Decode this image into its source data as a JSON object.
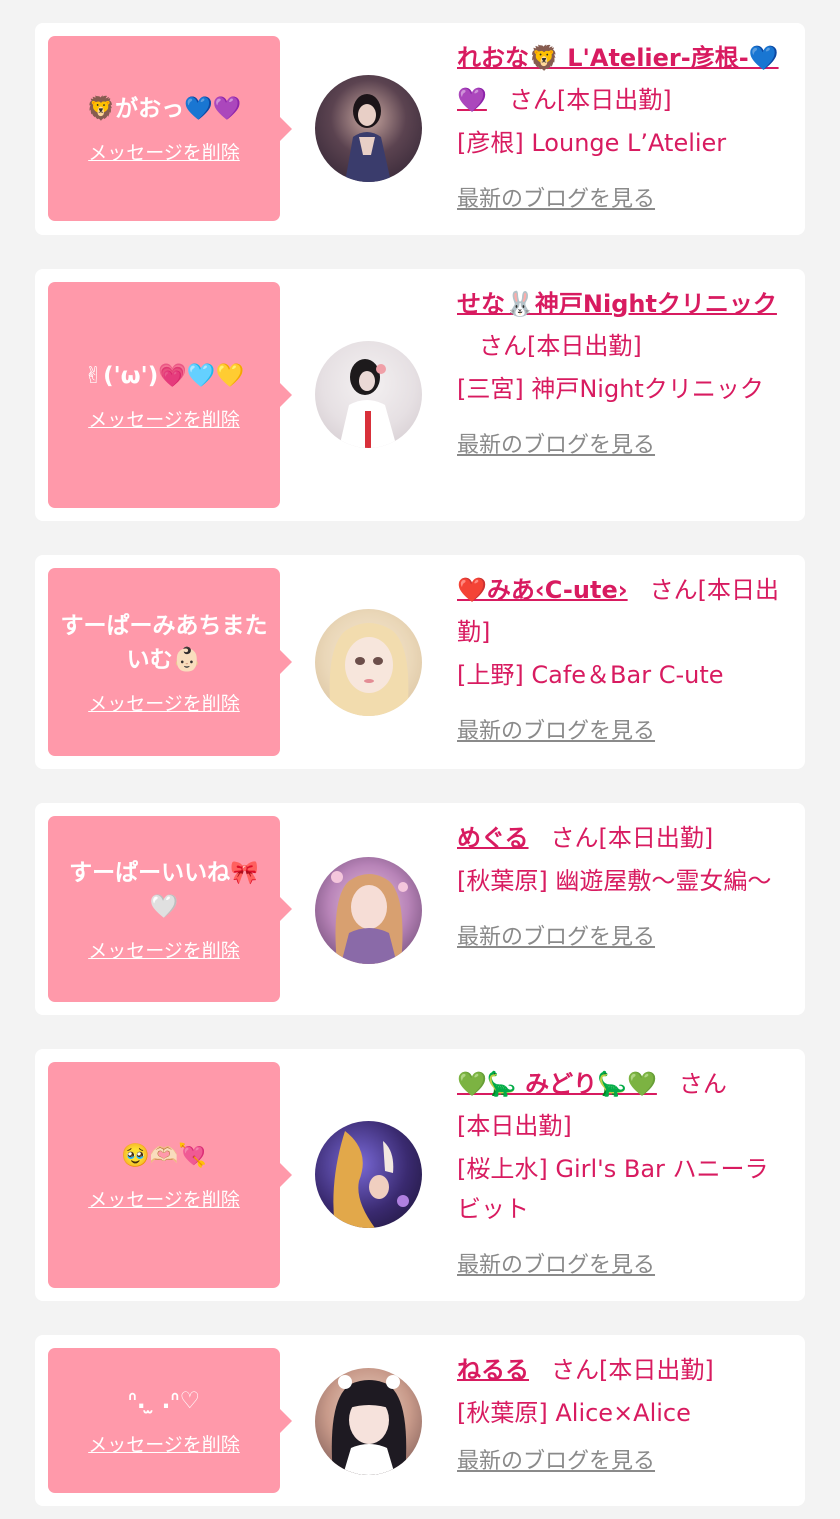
{
  "items": [
    {
      "message": "🦁がおっ💙💜",
      "delete_label": "メッセージを削除",
      "name": "れおな🦁 L'Atelier-彦根-💙💜",
      "honorific": "さん",
      "status": "[本日出勤]",
      "shop": "[彦根] Lounge L’Atelier",
      "blog_label": "最新のブログを見る"
    },
    {
      "message": "✌︎('ω')💗🩵💛",
      "delete_label": "メッセージを削除",
      "name": "せな🐰神戸Nightクリニック",
      "honorific": "さん",
      "status": "[本日出勤]",
      "shop": "[三宮] 神戸Nightクリニック",
      "blog_label": "最新のブログを見る"
    },
    {
      "message": "すーぱーみあちまたいむ👶🏻",
      "delete_label": "メッセージを削除",
      "name": "❤️みあ‹C-ute›",
      "honorific": "さん",
      "status": "[本日出勤]",
      "shop": "[上野] Cafe＆Bar C-ute",
      "blog_label": "最新のブログを見る"
    },
    {
      "message": "すーぱーいいね🎀🤍",
      "delete_label": "メッセージを削除",
      "name": "めぐる",
      "honorific": "さん",
      "status": "[本日出勤]",
      "shop": "[秋葉原] 幽遊屋敷〜霊女編〜",
      "blog_label": "最新のブログを見る"
    },
    {
      "message": "🥹🫶🏻💘",
      "delete_label": "メッセージを削除",
      "name": "💚🦕 みどり🦕💚",
      "honorific": "さん",
      "status": "[本日出勤]",
      "shop": "[桜上水] Girl's Bar ハニーラビット",
      "blog_label": "最新のブログを見る"
    },
    {
      "message": "ᐢ. ̫ .ᐢ♡",
      "delete_label": "メッセージを削除",
      "name": "ねるる",
      "honorific": "さん",
      "status": "[本日出勤]",
      "shop": "[秋葉原] Alice×Alice",
      "blog_label": "最新のブログを見る"
    }
  ],
  "colors": {
    "page_bg": "#f3f3f3",
    "card_bg": "#ffffff",
    "bubble_bg": "#ff99aa",
    "accent_pink": "#d81b60",
    "link_gray": "#8a8a8a"
  }
}
